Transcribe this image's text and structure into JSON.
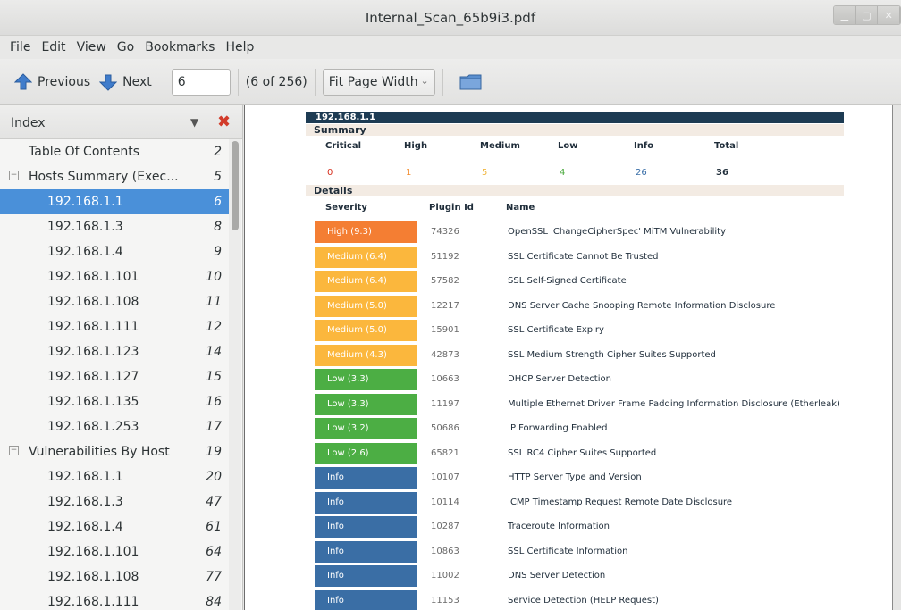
{
  "window": {
    "title": "Internal_Scan_65b9i3.pdf"
  },
  "menu": [
    "File",
    "Edit",
    "View",
    "Go",
    "Bookmarks",
    "Help"
  ],
  "toolbar": {
    "previous_label": "Previous",
    "next_label": "Next",
    "page_value": "6",
    "page_count": "(6 of 256)",
    "zoom_value": "Fit Page Width"
  },
  "sidebar": {
    "title": "Index",
    "items": [
      {
        "label": "Table Of Contents",
        "page": "2",
        "level": 0,
        "expander": false
      },
      {
        "label": "Hosts Summary (Exec...",
        "page": "5",
        "level": 0,
        "expander": true
      },
      {
        "label": "192.168.1.1",
        "page": "6",
        "level": 1,
        "selected": true
      },
      {
        "label": "192.168.1.3",
        "page": "8",
        "level": 1
      },
      {
        "label": "192.168.1.4",
        "page": "9",
        "level": 1
      },
      {
        "label": "192.168.1.101",
        "page": "10",
        "level": 1
      },
      {
        "label": "192.168.1.108",
        "page": "11",
        "level": 1
      },
      {
        "label": "192.168.1.111",
        "page": "12",
        "level": 1
      },
      {
        "label": "192.168.1.123",
        "page": "14",
        "level": 1
      },
      {
        "label": "192.168.1.127",
        "page": "15",
        "level": 1
      },
      {
        "label": "192.168.1.135",
        "page": "16",
        "level": 1
      },
      {
        "label": "192.168.1.253",
        "page": "17",
        "level": 1
      },
      {
        "label": "Vulnerabilities By Host",
        "page": "19",
        "level": 0,
        "expander": true
      },
      {
        "label": "192.168.1.1",
        "page": "20",
        "level": 1
      },
      {
        "label": "192.168.1.3",
        "page": "47",
        "level": 1
      },
      {
        "label": "192.168.1.4",
        "page": "61",
        "level": 1
      },
      {
        "label": "192.168.1.101",
        "page": "64",
        "level": 1
      },
      {
        "label": "192.168.1.108",
        "page": "77",
        "level": 1
      },
      {
        "label": "192.168.1.111",
        "page": "84",
        "level": 1
      }
    ]
  },
  "document": {
    "host": "192.168.1.1",
    "summary_label": "Summary",
    "summary_headers": [
      "Critical",
      "High",
      "Medium",
      "Low",
      "Info",
      "Total"
    ],
    "summary_values": [
      "0",
      "1",
      "5",
      "4",
      "26",
      "36"
    ],
    "summary_colors": [
      "#d6301f",
      "#f28b2c",
      "#f0b53c",
      "#4caa3f",
      "#3a6fa8",
      "#1f2d3a"
    ],
    "details_label": "Details",
    "details_headers": [
      "Severity",
      "Plugin Id",
      "Name"
    ],
    "vulns": [
      {
        "severity": "High (9.3)",
        "plugin": "74326",
        "name": "OpenSSL 'ChangeCipherSpec' MiTM Vulnerability",
        "color": "#f47e33"
      },
      {
        "severity": "Medium (6.4)",
        "plugin": "51192",
        "name": "SSL Certificate Cannot Be Trusted",
        "color": "#fbb73d"
      },
      {
        "severity": "Medium (6.4)",
        "plugin": "57582",
        "name": "SSL Self-Signed Certificate",
        "color": "#fbb73d"
      },
      {
        "severity": "Medium (5.0)",
        "plugin": "12217",
        "name": "DNS Server Cache Snooping Remote Information Disclosure",
        "color": "#fbb73d"
      },
      {
        "severity": "Medium (5.0)",
        "plugin": "15901",
        "name": "SSL Certificate Expiry",
        "color": "#fbb73d"
      },
      {
        "severity": "Medium (4.3)",
        "plugin": "42873",
        "name": "SSL Medium Strength Cipher Suites Supported",
        "color": "#fbb73d"
      },
      {
        "severity": "Low (3.3)",
        "plugin": "10663",
        "name": "DHCP Server Detection",
        "color": "#4cae44"
      },
      {
        "severity": "Low (3.3)",
        "plugin": "11197",
        "name": "Multiple Ethernet Driver Frame Padding Information Disclosure (Etherleak)",
        "color": "#4cae44"
      },
      {
        "severity": "Low (3.2)",
        "plugin": "50686",
        "name": "IP Forwarding Enabled",
        "color": "#4cae44"
      },
      {
        "severity": "Low (2.6)",
        "plugin": "65821",
        "name": "SSL RC4 Cipher Suites Supported",
        "color": "#4cae44"
      },
      {
        "severity": "Info",
        "plugin": "10107",
        "name": "HTTP Server Type and Version",
        "color": "#3a6ea5"
      },
      {
        "severity": "Info",
        "plugin": "10114",
        "name": "ICMP Timestamp Request Remote Date Disclosure",
        "color": "#3a6ea5"
      },
      {
        "severity": "Info",
        "plugin": "10287",
        "name": "Traceroute Information",
        "color": "#3a6ea5"
      },
      {
        "severity": "Info",
        "plugin": "10863",
        "name": "SSL Certificate Information",
        "color": "#3a6ea5"
      },
      {
        "severity": "Info",
        "plugin": "11002",
        "name": "DNS Server Detection",
        "color": "#3a6ea5"
      },
      {
        "severity": "Info",
        "plugin": "11153",
        "name": "Service Detection (HELP Request)",
        "color": "#3a6ea5"
      }
    ]
  }
}
